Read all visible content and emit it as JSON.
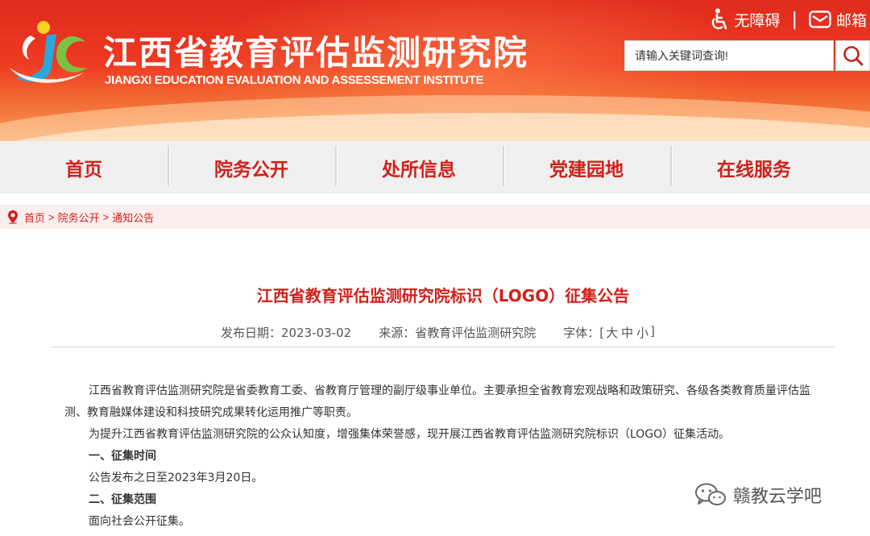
{
  "header": {
    "title": "江西省教育评估监测研究院",
    "subtitle": "JIANGXI EDUCATION EVALUATION AND ASSESSEMENT INSTITUTE",
    "links": {
      "accessibility": "无障碍",
      "separator": "|",
      "mail": "邮箱"
    },
    "search": {
      "value": "请输入关键词查询!"
    }
  },
  "nav": {
    "items": [
      {
        "label": "首页"
      },
      {
        "label": "院务公开"
      },
      {
        "label": "处所信息"
      },
      {
        "label": "党建园地"
      },
      {
        "label": "在线服务"
      }
    ]
  },
  "breadcrumb": {
    "home": "首页",
    "section": "院务公开",
    "current": "通知公告",
    "sep": ">"
  },
  "article": {
    "title": "江西省教育评估监测研究院标识（LOGO）征集公告",
    "date_label": "发布日期：2023-03-02",
    "source_label": "来源：省教育评估监测研究院",
    "font_label": "字体：[",
    "font_large": "大",
    "font_medium": "中",
    "font_small": "小",
    "font_end": "]",
    "paragraphs": {
      "p1": "江西省教育评估监测研究院是省委教育工委、省教育厅管理的副厅级事业单位。主要承担全省教育宏观战略和政策研究、各级各类教育质量评估监测、教育融媒体建设和科技研究成果转化运用推广等职责。",
      "p2": "为提升江西省教育评估监测研究院的公众认知度，增强集体荣誉感，现开展江西省教育评估监测研究院标识（LOGO）征集活动。",
      "h1": "一、征集时间",
      "p3": "公告发布之日至2023年3月20日。",
      "h2": "二、征集范围",
      "p4": "面向社会公开征集。"
    }
  },
  "watermark": {
    "text": "赣教云学吧"
  },
  "colors": {
    "brand_red": "#d3201a",
    "nav_bg": "#f0f0f0",
    "crumb_bg": "#fbeeee"
  }
}
